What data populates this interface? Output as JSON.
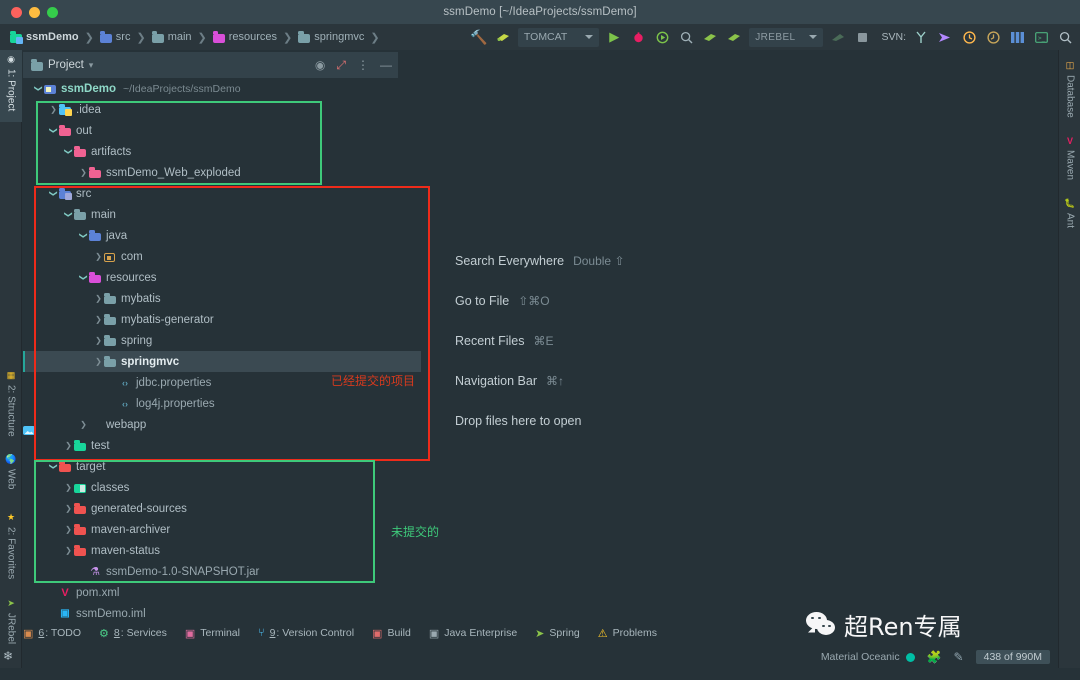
{
  "window": {
    "title": "ssmDemo [~/IdeaProjects/ssmDemo]",
    "traffic_close": "close-window",
    "traffic_min": "minimize-window",
    "traffic_max": "maximize-window"
  },
  "breadcrumb": [
    {
      "label": "ssmDemo",
      "icon": "module-folder-icon"
    },
    {
      "label": "src",
      "icon": "source-root-folder-icon"
    },
    {
      "label": "main",
      "icon": "folder-icon"
    },
    {
      "label": "resources",
      "icon": "resources-folder-icon"
    },
    {
      "label": "springmvc",
      "icon": "folder-icon"
    }
  ],
  "toolbar": {
    "build_icon": "hammer-icon",
    "tomcat_icon": "tomcat-icon",
    "run_config": "TOMCAT",
    "run_icon": "run-triangle-icon",
    "debug_icon": "debug-bug-icon",
    "run_coverage_icon": "run-with-coverage-icon",
    "profile_icon": "profiler-icon",
    "deploy_icon": "deploy-icon",
    "deploy_icon2": "redeploy-icon",
    "jrebel_label": "JREBEL",
    "jrebel_run_icon": "jrebel-run-icon",
    "stop_icon": "stop-square-icon",
    "svn_label": "SVN:",
    "svn_branch_icon": "branch-icon",
    "svn_update_icon": "update-project-icon",
    "svn_commit_icon": "commit-icon",
    "svn_history_icon": "history-icon",
    "layout_icon": "layout-grid-icon",
    "terminal_icon": "terminal-icon",
    "search_icon": "search-icon"
  },
  "left_stripe": [
    {
      "label": "1: Project",
      "icon": "project-icon",
      "selected": true
    },
    {
      "label": "2: Structure",
      "icon": "structure-icon",
      "selected": false
    },
    {
      "label": "Web",
      "icon": "web-globe-icon",
      "selected": false
    },
    {
      "label": "2: Favorites",
      "icon": "star-icon",
      "selected": false
    },
    {
      "label": "JRebel",
      "icon": "jrebel-icon",
      "selected": false
    }
  ],
  "left_stripe_bottom_icon": "settings-gear-icon",
  "right_stripe": [
    {
      "label": "Database",
      "icon": "database-icon"
    },
    {
      "label": "Maven",
      "icon": "maven-m-icon"
    },
    {
      "label": "Ant",
      "icon": "ant-icon"
    }
  ],
  "tool_window": {
    "title": "Project",
    "chevron_icon": "chevron-down-icon",
    "locate_icon": "select-opened-file-icon",
    "collapse_icon": "collapse-all-icon",
    "options_icon": "more-options-icon",
    "hide_icon": "hide-window-icon"
  },
  "tree": [
    {
      "id": "root",
      "depth": 0,
      "arrow": "open",
      "icon": "module-folder-icon",
      "icon_class": "gl-module",
      "label": "ssmDemo",
      "bold": true,
      "path": "~/IdeaProjects/ssmDemo"
    },
    {
      "id": "idea",
      "depth": 1,
      "arrow": "closed",
      "icon": "idea-folder-icon",
      "icon_class": "f-sky",
      "label": ".idea"
    },
    {
      "id": "out",
      "depth": 1,
      "arrow": "open",
      "icon": "folder-icon-pink",
      "icon_class": "f-pink",
      "label": "out"
    },
    {
      "id": "artifacts",
      "depth": 2,
      "arrow": "open",
      "icon": "folder-icon-pink",
      "icon_class": "f-pink",
      "label": "artifacts"
    },
    {
      "id": "webexploded",
      "depth": 3,
      "arrow": "closed",
      "icon": "folder-icon-pink",
      "icon_class": "f-pink",
      "label": "ssmDemo_Web_exploded"
    },
    {
      "id": "src",
      "depth": 1,
      "arrow": "open",
      "icon": "source-root-folder-icon",
      "icon_class": "gl-srcroot",
      "label": "src"
    },
    {
      "id": "main",
      "depth": 2,
      "arrow": "open",
      "icon": "folder-icon",
      "icon_class": "f-teal",
      "label": "main"
    },
    {
      "id": "java",
      "depth": 3,
      "arrow": "open",
      "icon": "java-source-folder-icon",
      "icon_class": "f-blue",
      "label": "java"
    },
    {
      "id": "com",
      "depth": 4,
      "arrow": "closed",
      "icon": "package-icon",
      "icon_class": "gl-com",
      "label": "com"
    },
    {
      "id": "resources",
      "depth": 3,
      "arrow": "open",
      "icon": "resources-folder-icon",
      "icon_class": "f-mag",
      "label": "resources"
    },
    {
      "id": "mybatis",
      "depth": 4,
      "arrow": "closed",
      "icon": "folder-icon",
      "icon_class": "f-teal",
      "label": "mybatis"
    },
    {
      "id": "mybatisgen",
      "depth": 4,
      "arrow": "closed",
      "icon": "folder-icon",
      "icon_class": "f-teal",
      "label": "mybatis-generator"
    },
    {
      "id": "spring",
      "depth": 4,
      "arrow": "closed",
      "icon": "folder-icon",
      "icon_class": "f-teal",
      "label": "spring"
    },
    {
      "id": "springmvc",
      "depth": 4,
      "arrow": "closed",
      "icon": "folder-icon",
      "icon_class": "f-teal",
      "label": "springmvc",
      "selected": true
    },
    {
      "id": "jdbcprops",
      "depth": 5,
      "arrow": "none",
      "icon": "properties-file-icon",
      "icon_class": "gl-props",
      "label": "jdbc.properties",
      "file": true
    },
    {
      "id": "log4jprops",
      "depth": 5,
      "arrow": "none",
      "icon": "properties-file-icon",
      "icon_class": "gl-props",
      "label": "log4j.properties",
      "file": true
    },
    {
      "id": "webapp",
      "depth": 3,
      "arrow": "closed",
      "icon": "webapp-folder-icon",
      "icon_class": "gl-webapp",
      "label": "webapp"
    },
    {
      "id": "test",
      "depth": 2,
      "arrow": "closed",
      "icon": "test-source-folder-icon",
      "icon_class": "f-green",
      "label": "test"
    },
    {
      "id": "target",
      "depth": 1,
      "arrow": "open",
      "icon": "folder-icon-red",
      "icon_class": "f-red",
      "label": "target"
    },
    {
      "id": "classes",
      "depth": 2,
      "arrow": "closed",
      "icon": "classes-folder-icon",
      "icon_class": "gl-classes",
      "label": "classes"
    },
    {
      "id": "gensources",
      "depth": 2,
      "arrow": "closed",
      "icon": "folder-icon-red",
      "icon_class": "f-red",
      "label": "generated-sources"
    },
    {
      "id": "mavenarch",
      "depth": 2,
      "arrow": "closed",
      "icon": "folder-icon-red",
      "icon_class": "f-red",
      "label": "maven-archiver"
    },
    {
      "id": "mavenstatus",
      "depth": 2,
      "arrow": "closed",
      "icon": "folder-icon-red",
      "icon_class": "f-red",
      "label": "maven-status"
    },
    {
      "id": "jar",
      "depth": 3,
      "arrow": "none",
      "icon": "jar-file-icon",
      "icon_class": "gl-jar",
      "label": "ssmDemo-1.0-SNAPSHOT.jar",
      "file": true
    },
    {
      "id": "pom",
      "depth": 1,
      "arrow": "none",
      "icon": "maven-pom-file-icon",
      "icon_class": "gl-xml",
      "label": "pom.xml",
      "file": true
    },
    {
      "id": "iml",
      "depth": 1,
      "arrow": "none",
      "icon": "iml-module-file-icon",
      "icon_class": "gl-iml",
      "label": "ssmDemo.iml",
      "file": true
    }
  ],
  "annotations": [
    {
      "id": "committed",
      "label": "已经提交的项目",
      "color": "#d63a1e",
      "box_color": "#2ecc71"
    },
    {
      "id": "uncommitted",
      "label": "未提交的",
      "color": "#3ec97a",
      "box_color": "#3ec97a"
    }
  ],
  "annotation_colors": {
    "red_box": "#ee2b1a",
    "green_box": "#3ec97a"
  },
  "hints": [
    {
      "name": "Search Everywhere",
      "key": "Double ⇧"
    },
    {
      "name": "Go to File",
      "key": "⇧⌘O"
    },
    {
      "name": "Recent Files",
      "key": "⌘E"
    },
    {
      "name": "Navigation Bar",
      "key": "⌘↑"
    },
    {
      "name": "Drop files here to open",
      "key": ""
    }
  ],
  "bottom_bar": [
    {
      "num": "6",
      "label": ": TODO",
      "icon": "todo-icon",
      "color": "#d88b4f"
    },
    {
      "num": "8",
      "label": ": Services",
      "icon": "services-icon",
      "color": "#4cd18a"
    },
    {
      "num": "",
      "label": "Terminal",
      "icon": "terminal-icon",
      "color": "#e06c9f"
    },
    {
      "num": "9",
      "label": ": Version Control",
      "icon": "version-control-icon",
      "color": "#4fc3f7"
    },
    {
      "num": "",
      "label": "Build",
      "icon": "build-icon",
      "color": "#e06c6c"
    },
    {
      "num": "",
      "label": "Java Enterprise",
      "icon": "java-enterprise-icon",
      "color": "#9aa9b0"
    },
    {
      "num": "",
      "label": "Spring",
      "icon": "spring-leaf-icon",
      "color": "#8bc34a"
    },
    {
      "num": "",
      "label": "Problems",
      "icon": "problems-warning-icon",
      "color": "#ffca28"
    }
  ],
  "status_bar": {
    "theme": "Material Oceanic",
    "theme_dot_color": "#00bfa5",
    "plugin_icon": "plugin-puzzle-icon",
    "edit_icon": "pencil-edit-icon",
    "memory": "438 of 990M"
  },
  "watermark": {
    "text": "超Ren专属",
    "icon": "wechat-icon"
  }
}
